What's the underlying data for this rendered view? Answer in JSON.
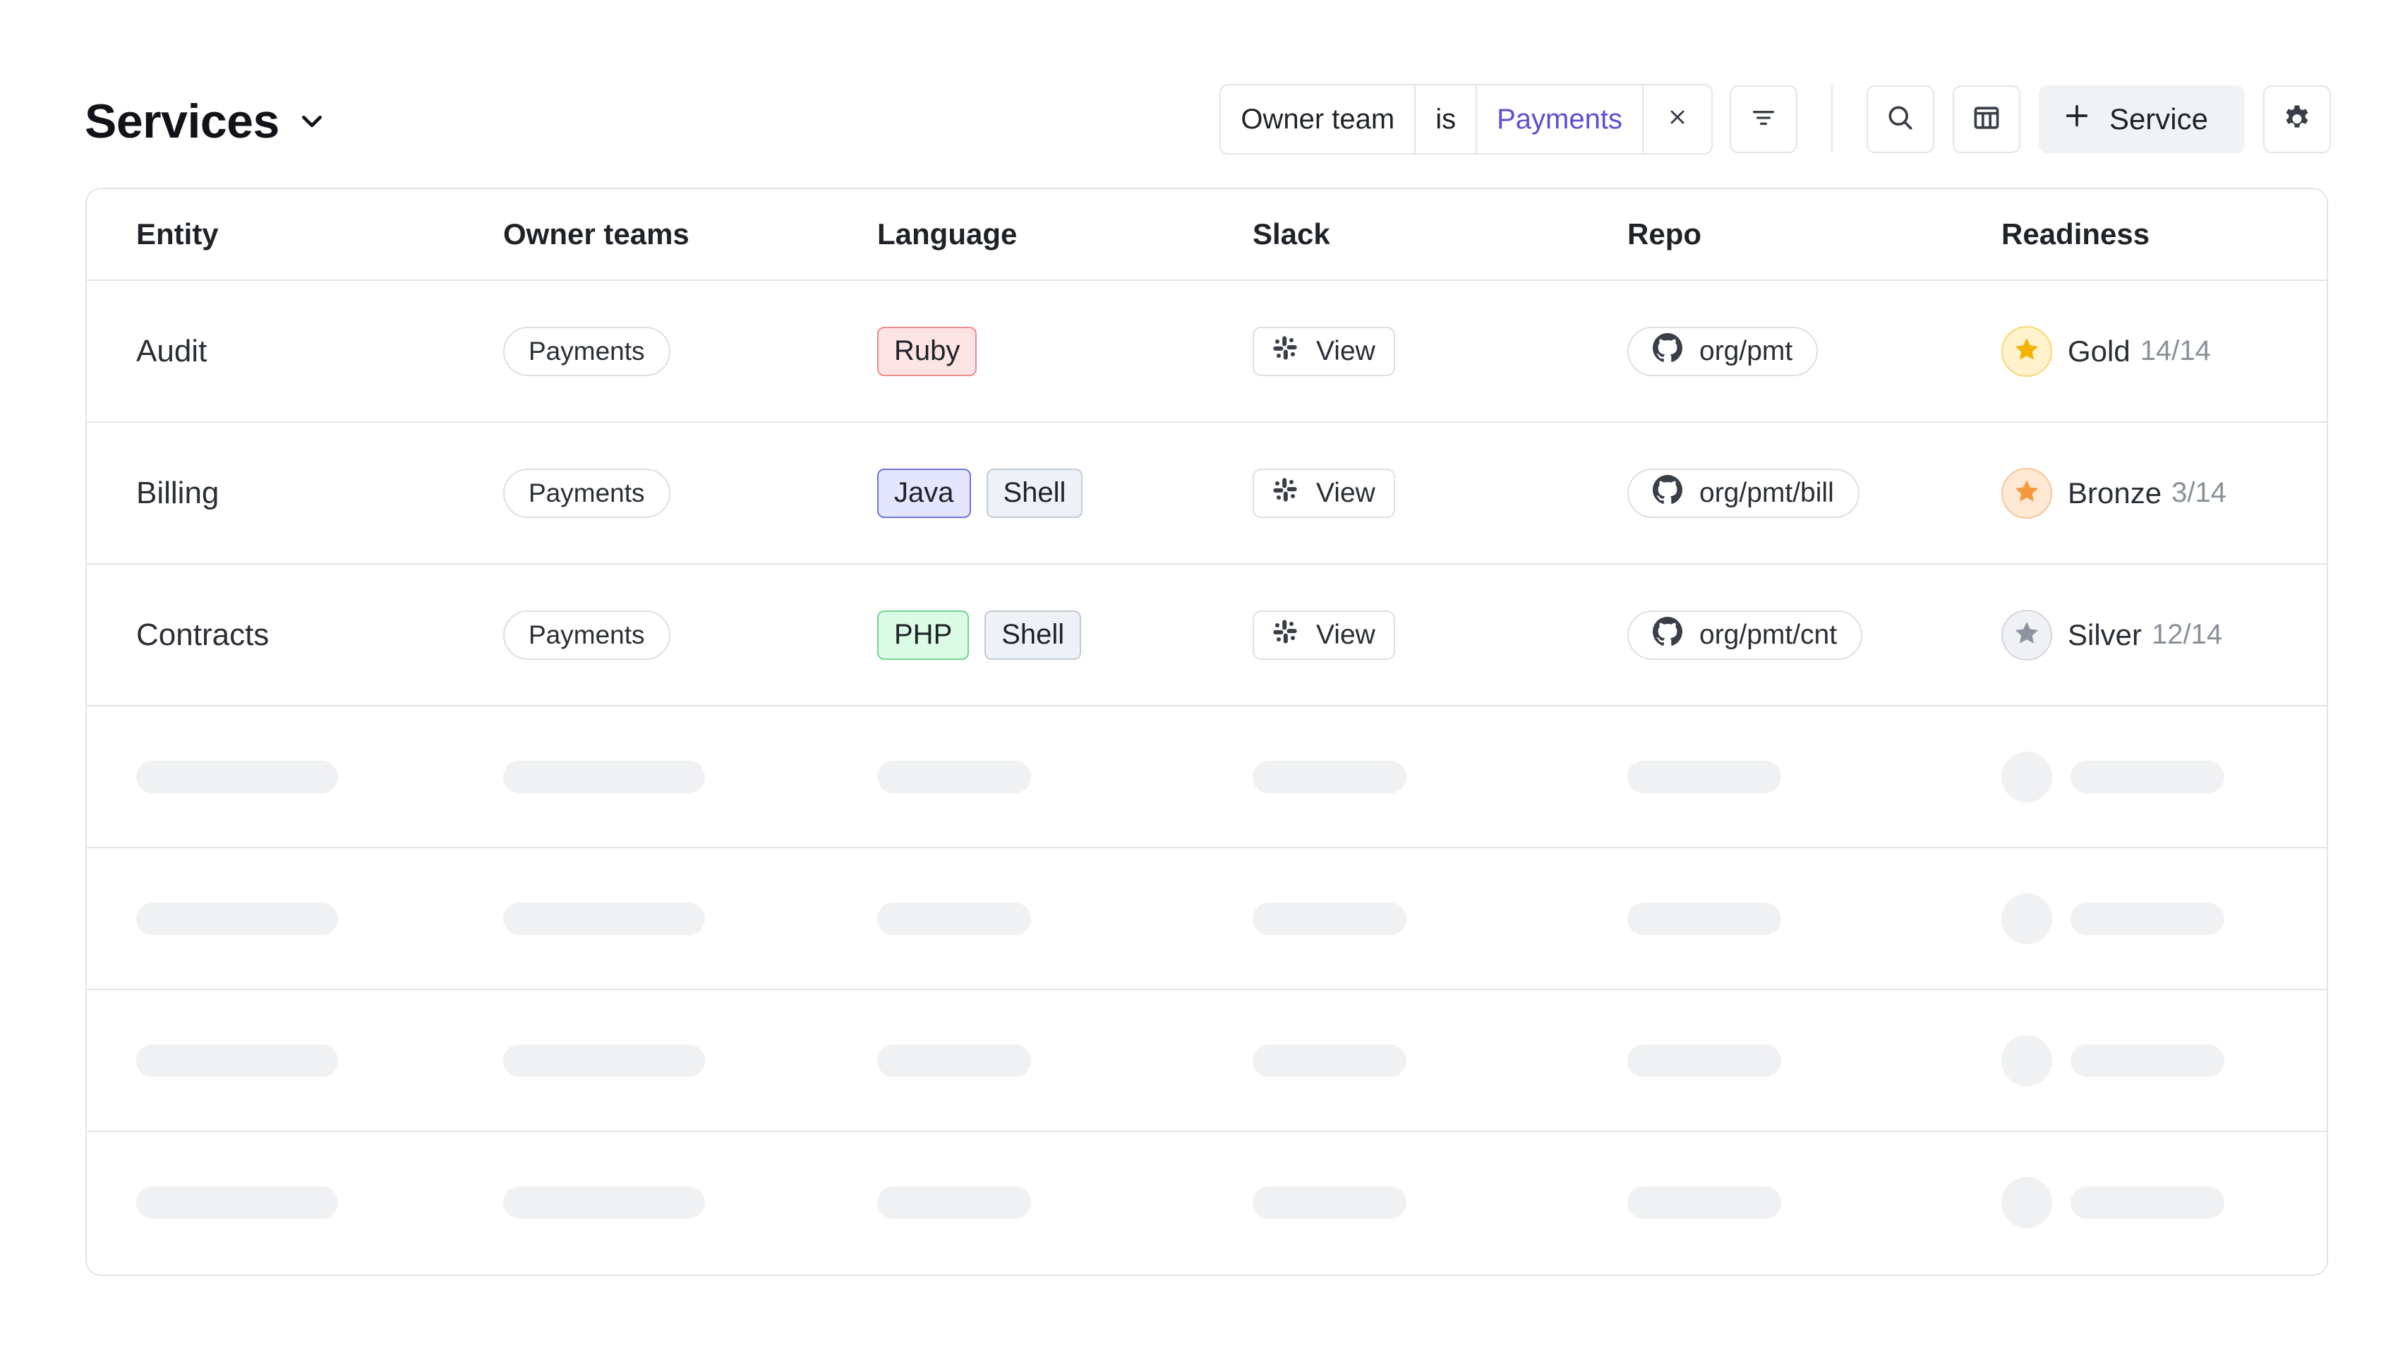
{
  "header": {
    "title": "Services",
    "filter": {
      "field": "Owner team",
      "operator": "is",
      "value": "Payments"
    },
    "add_label": "Service"
  },
  "table": {
    "columns": [
      "Entity",
      "Owner teams",
      "Language",
      "Slack",
      "Repo",
      "Readiness"
    ],
    "rows": [
      {
        "entity": "Audit",
        "owner": "Payments",
        "languages": [
          {
            "name": "Ruby",
            "bg": "#fde4e4",
            "border": "#ee8c8c"
          }
        ],
        "slack": "View",
        "repo": "org/pmt",
        "level": "Gold",
        "score": "14/14",
        "badge": {
          "bg": "#fff2cc",
          "border": "#fad776",
          "star": "#f5b301"
        }
      },
      {
        "entity": "Billing",
        "owner": "Payments",
        "languages": [
          {
            "name": "Java",
            "bg": "#e3e6fd",
            "border": "#6f74d6"
          },
          {
            "name": "Shell",
            "bg": "#eef2f7",
            "border": "#c3cbd6"
          }
        ],
        "slack": "View",
        "repo": "org/pmt/bill",
        "level": "Bronze",
        "score": "3/14",
        "badge": {
          "bg": "#ffe8d4",
          "border": "#f7c59a",
          "star": "#f59a3c"
        }
      },
      {
        "entity": "Contracts",
        "owner": "Payments",
        "languages": [
          {
            "name": "PHP",
            "bg": "#dcfbe6",
            "border": "#6fd68f"
          },
          {
            "name": "Shell",
            "bg": "#eef2f7",
            "border": "#c3cbd6"
          }
        ],
        "slack": "View",
        "repo": "org/pmt/cnt",
        "level": "Silver",
        "score": "12/14",
        "badge": {
          "bg": "#f0f1f4",
          "border": "#d4d8de",
          "star": "#8d949e"
        }
      }
    ],
    "skeleton_rows": 4
  },
  "icons": {
    "title_chevron": "chevron-down-icon",
    "filter_clear": "close-icon",
    "filter_menu": "filter-lines-icon",
    "search": "search-icon",
    "columns": "columns-icon",
    "add": "plus-icon",
    "settings": "gear-icon",
    "slack": "slack-icon",
    "github": "github-icon",
    "star": "star-icon"
  }
}
